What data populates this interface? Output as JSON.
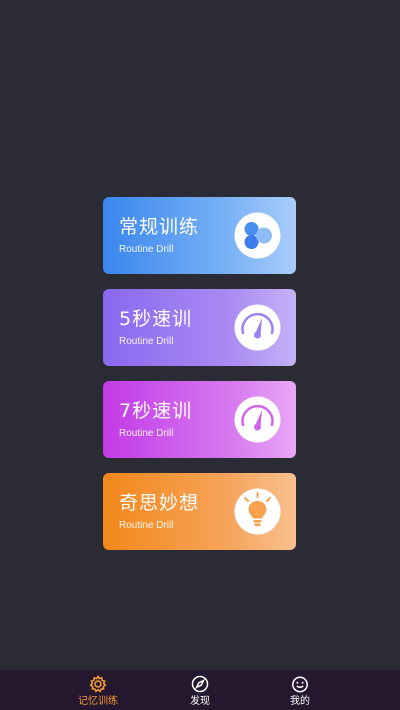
{
  "cards": [
    {
      "title": "常规训练",
      "subtitle": "Routine Drill",
      "icon": "circles-icon",
      "color": "#3a86ee"
    },
    {
      "title": "5秒速训",
      "subtitle": "Routine Drill",
      "icon": "speedometer-icon",
      "color": "#8a68f0"
    },
    {
      "title": "7秒速训",
      "subtitle": "Routine Drill",
      "icon": "speedometer-icon",
      "color": "#c23ae6"
    },
    {
      "title": "奇思妙想",
      "subtitle": "Routine Drill",
      "icon": "lightbulb-icon",
      "color": "#f3871a"
    }
  ],
  "tabbar": {
    "items": [
      {
        "label": "记忆训练",
        "icon": "gear-icon",
        "active": true
      },
      {
        "label": "发现",
        "icon": "compass-icon",
        "active": false
      },
      {
        "label": "我的",
        "icon": "face-icon",
        "active": false
      }
    ],
    "active_color": "#f39a2e"
  },
  "colors": {
    "background": "#2a2b35",
    "tabbar_background": "#24172e"
  }
}
